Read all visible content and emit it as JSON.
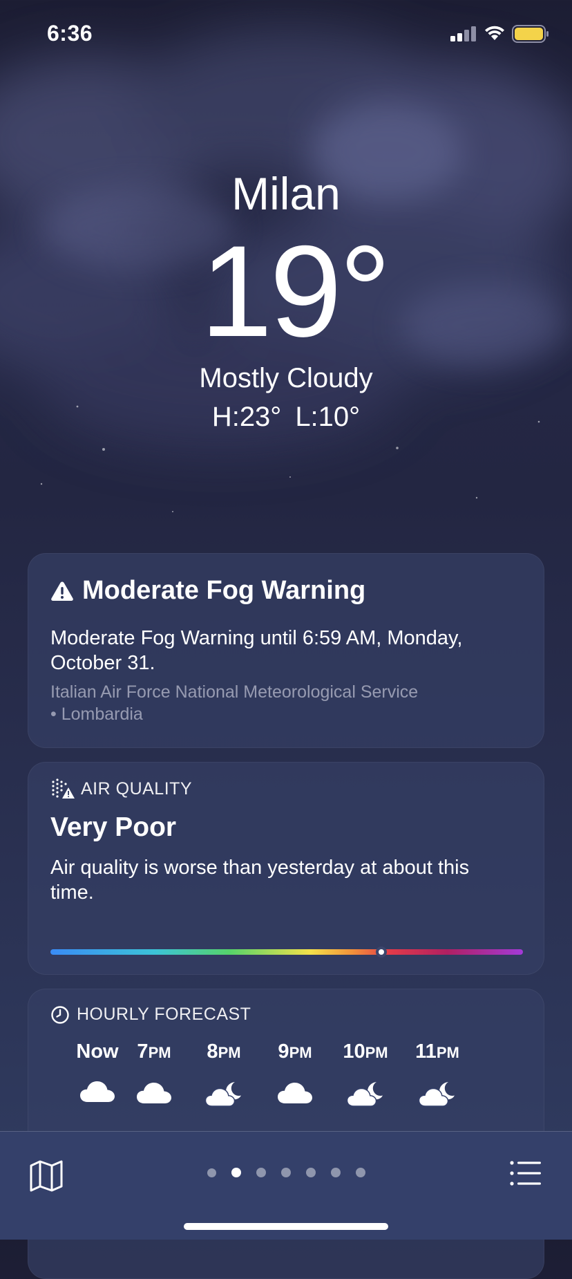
{
  "status_bar": {
    "time": "6:36"
  },
  "location": {
    "city": "Milan",
    "temperature": "19°",
    "condition": "Mostly Cloudy",
    "high": "H:23°",
    "low": "L:10°"
  },
  "alert": {
    "icon": "warning-triangle-icon",
    "title": "Moderate Fog Warning",
    "body": "Moderate Fog Warning until 6:59 AM, Monday, October 31.",
    "source": "Italian Air Force National Meteorological Service",
    "region": "• Lombardia"
  },
  "air_quality": {
    "icon": "air-quality-icon",
    "header": "AIR QUALITY",
    "level": "Very Poor",
    "description": "Air quality is worse than yesterday at about this time.",
    "scale_position": 0.7
  },
  "hourly": {
    "icon": "clock-icon",
    "header": "HOURLY FORECAST",
    "items": [
      {
        "time": "Now",
        "period": "",
        "icon": "cloud"
      },
      {
        "time": "7",
        "period": "PM",
        "icon": "cloud"
      },
      {
        "time": "8",
        "period": "PM",
        "icon": "moon-cloud"
      },
      {
        "time": "9",
        "period": "PM",
        "icon": "cloud"
      },
      {
        "time": "10",
        "period": "PM",
        "icon": "moon-cloud"
      },
      {
        "time": "11",
        "period": "PM",
        "icon": "moon-cloud"
      }
    ]
  },
  "tab_bar": {
    "map_icon": "map-icon",
    "list_icon": "list-icon",
    "page_count": 7,
    "active_page": 1
  }
}
